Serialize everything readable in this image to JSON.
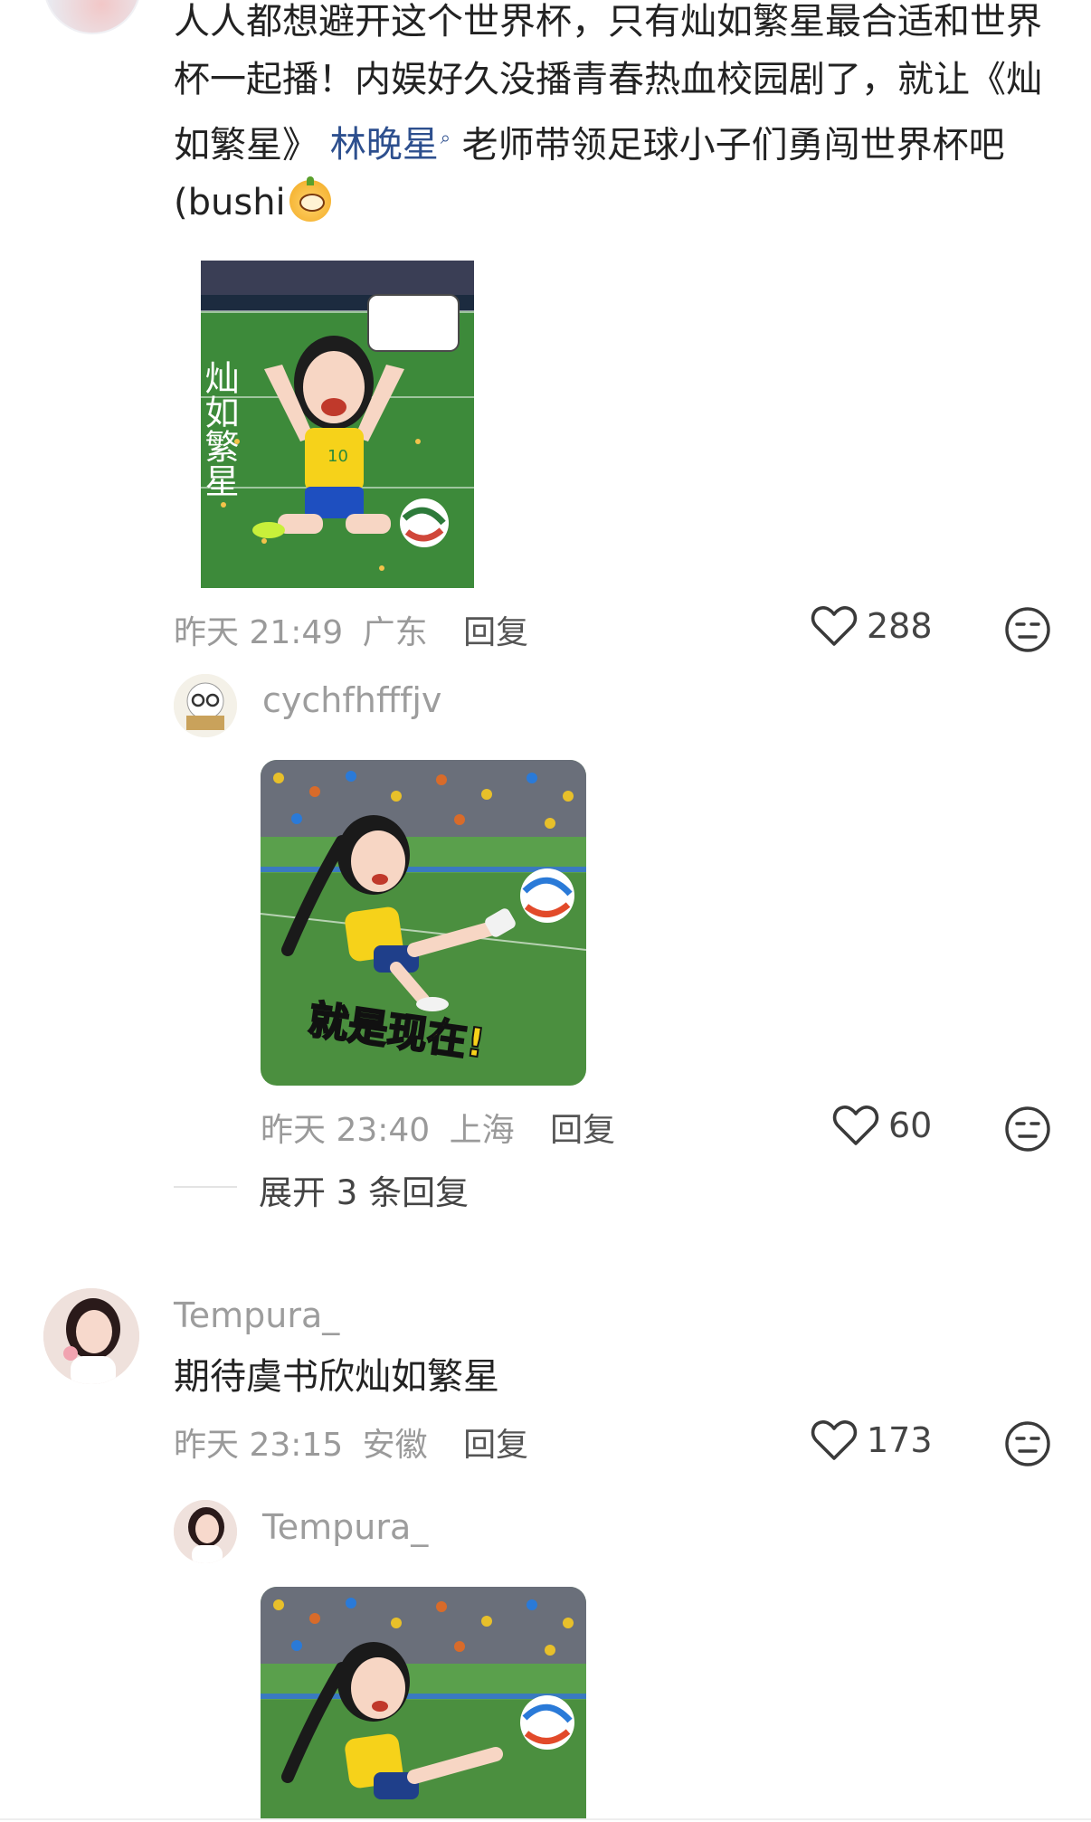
{
  "comments": [
    {
      "text_before": "人人都想避开这个世界杯，只有灿如繁星最合适和世界杯一起播！内娱好久没播青春热血校园剧了，就让《灿如繁星》",
      "mention": "林晚星",
      "text_after": "老师带领足球小子们勇闯世界杯吧 (bushi",
      "image_overlay_text": "灿如繁星",
      "time": "昨天 21:49",
      "location": "广东",
      "reply_label": "回复",
      "likes": "288",
      "replies": [
        {
          "username": "cychfhfffjv",
          "image_caption": "就是现在!",
          "time": "昨天 23:40",
          "location": "上海",
          "reply_label": "回复",
          "likes": "60"
        }
      ],
      "expand_label": "展开 3 条回复"
    },
    {
      "username": "Tempura_",
      "text": "期待虞书欣灿如繁星",
      "time": "昨天 23:15",
      "location": "安徽",
      "reply_label": "回复",
      "likes": "173",
      "replies": [
        {
          "username": "Tempura_"
        }
      ]
    }
  ],
  "colors": {
    "mention": "#2d4f8e",
    "meta": "#9a9a9a",
    "pitch": "#3d8a3a",
    "jersey": "#f6d21a"
  },
  "icons": [
    "heart-icon",
    "emoji-face-icon",
    "search-mark-icon"
  ]
}
